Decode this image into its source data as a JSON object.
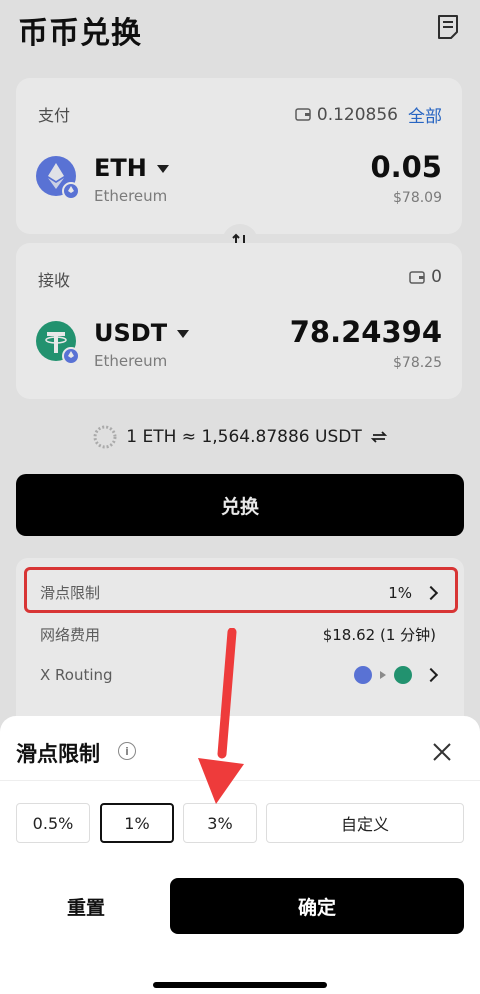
{
  "header": {
    "title": "币币兑换"
  },
  "pay": {
    "label": "支付",
    "balance": "0.120856",
    "all_label": "全部",
    "token": "ETH",
    "network": "Ethereum",
    "amount": "0.05",
    "usd_value": "$78.09"
  },
  "receive": {
    "label": "接收",
    "balance": "0",
    "token": "USDT",
    "network": "Ethereum",
    "amount": "78.24394",
    "usd_value": "$78.25"
  },
  "rate": {
    "text": "1 ETH ≈ 1,564.87886 USDT"
  },
  "exchange_button": {
    "label": "兑换"
  },
  "details": {
    "slippage_label": "滑点限制",
    "slippage_value": "1%",
    "fee_label": "网络费用",
    "fee_value": "$18.62 (1 分钟)",
    "routing_label": "X Routing"
  },
  "sheet": {
    "title": "滑点限制",
    "options": [
      "0.5%",
      "1%",
      "3%",
      "自定义"
    ],
    "selected": "1%",
    "reset_label": "重置",
    "confirm_label": "确定"
  },
  "colors": {
    "accent_blue": "#2b6fd6",
    "eth": "#627eea",
    "usdt": "#26a17b",
    "highlight_red": "#ee3b3b"
  }
}
